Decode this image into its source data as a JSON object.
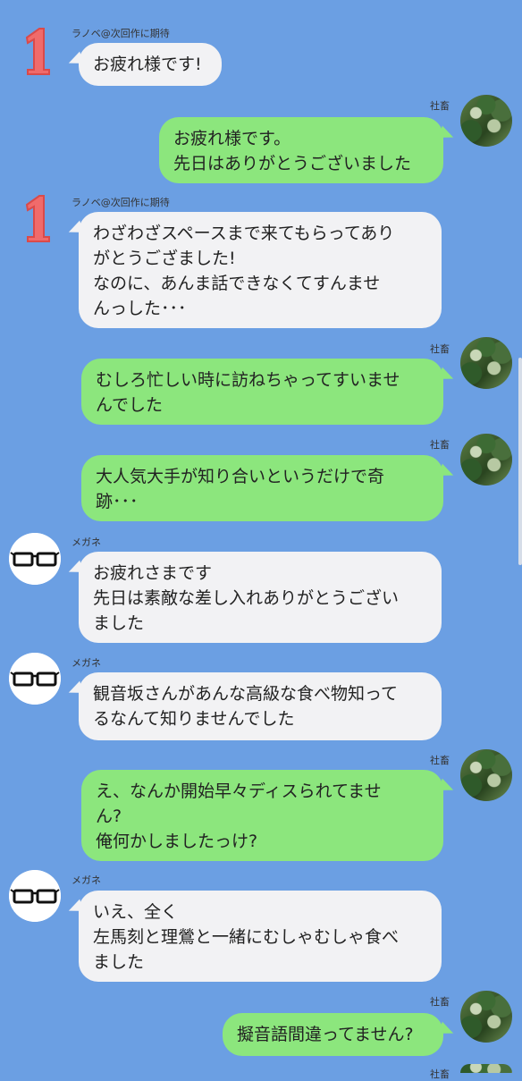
{
  "messages": [
    {
      "side": "left",
      "avatar": "number-one-icon",
      "sender": "ラノベ@次回作に期待",
      "text": "お疲れ様です!"
    },
    {
      "side": "right",
      "avatar": "forest-photo",
      "sender": "社畜",
      "text": "お疲れ様です。\n先日はありがとうございました"
    },
    {
      "side": "left",
      "avatar": "number-one-icon",
      "sender": "ラノベ@次回作に期待",
      "text": "わざわざスペースまで来てもらってあり\nがとうござました!\nなのに、あんま話できなくてすんませ\nんっした･･･"
    },
    {
      "side": "right",
      "avatar": "forest-photo",
      "sender": "社畜",
      "text": "むしろ忙しい時に訪ねちゃってすいませ\nんでした"
    },
    {
      "side": "right",
      "avatar": "forest-photo",
      "sender": "社畜",
      "text": "大人気大手が知り合いというだけで奇\n跡･･･"
    },
    {
      "side": "left",
      "avatar": "glasses-icon",
      "sender": "メガネ",
      "text": "お疲れさまです\n先日は素敵な差し入れありがとうござい\nました"
    },
    {
      "side": "left",
      "avatar": "glasses-icon",
      "sender": "メガネ",
      "text": "観音坂さんがあんな高級な食べ物知って\nるなんて知りませんでした"
    },
    {
      "side": "right",
      "avatar": "forest-photo",
      "sender": "社畜",
      "text": "え、なんか開始早々ディスられてませ\nん?\n俺何かしましたっけ?"
    },
    {
      "side": "left",
      "avatar": "glasses-icon",
      "sender": "メガネ",
      "text": "いえ、全く\n左馬刻と理鶯と一緒にむしゃむしゃ食べ\nました"
    },
    {
      "side": "right",
      "avatar": "forest-photo",
      "sender": "社畜",
      "text": "擬音語間違ってません?"
    },
    {
      "side": "right",
      "avatar": "forest-photo",
      "sender": "社畜",
      "text": ""
    }
  ],
  "colors": {
    "background": "#6b9fe3",
    "left_bubble": "#f2f2f4",
    "right_bubble": "#8ce67d",
    "number_one": "#f06b6b"
  }
}
